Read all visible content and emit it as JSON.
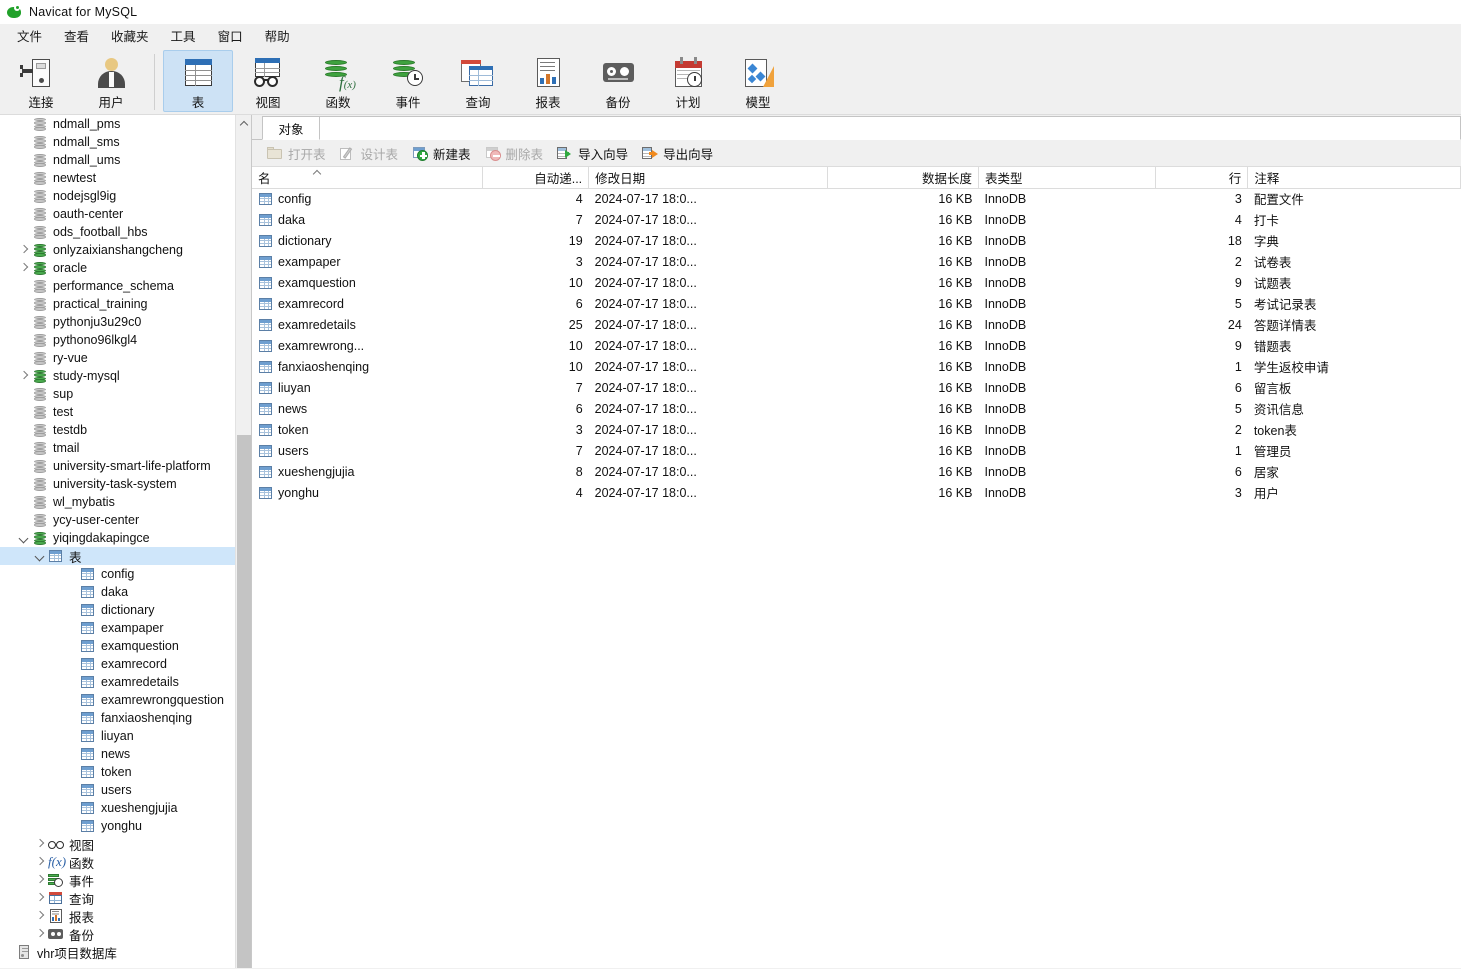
{
  "window": {
    "title": "Navicat for MySQL",
    "logo_icon": "navicat-logo-icon"
  },
  "menubar": [
    {
      "label": "文件"
    },
    {
      "label": "查看"
    },
    {
      "label": "收藏夹"
    },
    {
      "label": "工具"
    },
    {
      "label": "窗口"
    },
    {
      "label": "帮助"
    }
  ],
  "toolbar": [
    {
      "label": "连接",
      "icon": "connection-icon",
      "active": false
    },
    {
      "label": "用户",
      "icon": "user-icon",
      "active": false
    },
    {
      "label": "表",
      "icon": "table-icon",
      "active": true
    },
    {
      "label": "视图",
      "icon": "view-icon",
      "active": false
    },
    {
      "label": "函数",
      "icon": "function-icon",
      "active": false
    },
    {
      "label": "事件",
      "icon": "event-icon",
      "active": false
    },
    {
      "label": "查询",
      "icon": "query-icon",
      "active": false
    },
    {
      "label": "报表",
      "icon": "report-icon",
      "active": false
    },
    {
      "label": "备份",
      "icon": "backup-icon",
      "active": false
    },
    {
      "label": "计划",
      "icon": "schedule-icon",
      "active": false
    },
    {
      "label": "模型",
      "icon": "model-icon",
      "active": false
    }
  ],
  "sidebar": {
    "scrollbar": {
      "up_arrow_icon": "scroll-up-arrow-icon"
    },
    "nodes": [
      {
        "label": "ndmall_pms",
        "icon": "database-icon",
        "state": "closed",
        "indent": 2,
        "twisty": "none",
        "selected": false
      },
      {
        "label": "ndmall_sms",
        "icon": "database-icon",
        "state": "closed",
        "indent": 2,
        "twisty": "none",
        "selected": false
      },
      {
        "label": "ndmall_ums",
        "icon": "database-icon",
        "state": "closed",
        "indent": 2,
        "twisty": "none",
        "selected": false
      },
      {
        "label": "newtest",
        "icon": "database-icon",
        "state": "closed",
        "indent": 2,
        "twisty": "none",
        "selected": false
      },
      {
        "label": "nodejsgl9ig",
        "icon": "database-icon",
        "state": "closed",
        "indent": 2,
        "twisty": "none",
        "selected": false
      },
      {
        "label": "oauth-center",
        "icon": "database-icon",
        "state": "closed",
        "indent": 2,
        "twisty": "none",
        "selected": false
      },
      {
        "label": "ods_football_hbs",
        "icon": "database-icon",
        "state": "closed",
        "indent": 2,
        "twisty": "none",
        "selected": false
      },
      {
        "label": "onlyzaixianshangcheng",
        "icon": "database-icon",
        "state": "open",
        "indent": 2,
        "twisty": "closed",
        "selected": false
      },
      {
        "label": "oracle",
        "icon": "database-icon",
        "state": "open",
        "indent": 2,
        "twisty": "closed",
        "selected": false
      },
      {
        "label": "performance_schema",
        "icon": "database-icon",
        "state": "closed",
        "indent": 2,
        "twisty": "none",
        "selected": false
      },
      {
        "label": "practical_training",
        "icon": "database-icon",
        "state": "closed",
        "indent": 2,
        "twisty": "none",
        "selected": false
      },
      {
        "label": "pythonju3u29c0",
        "icon": "database-icon",
        "state": "closed",
        "indent": 2,
        "twisty": "none",
        "selected": false
      },
      {
        "label": "pythono96lkgl4",
        "icon": "database-icon",
        "state": "closed",
        "indent": 2,
        "twisty": "none",
        "selected": false
      },
      {
        "label": "ry-vue",
        "icon": "database-icon",
        "state": "closed",
        "indent": 2,
        "twisty": "none",
        "selected": false
      },
      {
        "label": "study-mysql",
        "icon": "database-icon",
        "state": "open",
        "indent": 2,
        "twisty": "closed",
        "selected": false
      },
      {
        "label": "sup",
        "icon": "database-icon",
        "state": "closed",
        "indent": 2,
        "twisty": "none",
        "selected": false
      },
      {
        "label": "test",
        "icon": "database-icon",
        "state": "closed",
        "indent": 2,
        "twisty": "none",
        "selected": false
      },
      {
        "label": "testdb",
        "icon": "database-icon",
        "state": "closed",
        "indent": 2,
        "twisty": "none",
        "selected": false
      },
      {
        "label": "tmail",
        "icon": "database-icon",
        "state": "closed",
        "indent": 2,
        "twisty": "none",
        "selected": false
      },
      {
        "label": "university-smart-life-platform",
        "icon": "database-icon",
        "state": "closed",
        "indent": 2,
        "twisty": "none",
        "selected": false
      },
      {
        "label": "university-task-system",
        "icon": "database-icon",
        "state": "closed",
        "indent": 2,
        "twisty": "none",
        "selected": false
      },
      {
        "label": "wl_mybatis",
        "icon": "database-icon",
        "state": "closed",
        "indent": 2,
        "twisty": "none",
        "selected": false
      },
      {
        "label": "ycy-user-center",
        "icon": "database-icon",
        "state": "closed",
        "indent": 2,
        "twisty": "none",
        "selected": false
      },
      {
        "label": "yiqingdakapingce",
        "icon": "database-icon",
        "state": "open",
        "indent": 2,
        "twisty": "open",
        "selected": false
      },
      {
        "label": "表",
        "icon": "tables-folder-icon",
        "state": "",
        "indent": 3,
        "twisty": "open",
        "selected": true
      },
      {
        "label": "config",
        "icon": "table-item-icon",
        "state": "",
        "indent": 5,
        "twisty": "none",
        "selected": false
      },
      {
        "label": "daka",
        "icon": "table-item-icon",
        "state": "",
        "indent": 5,
        "twisty": "none",
        "selected": false
      },
      {
        "label": "dictionary",
        "icon": "table-item-icon",
        "state": "",
        "indent": 5,
        "twisty": "none",
        "selected": false
      },
      {
        "label": "exampaper",
        "icon": "table-item-icon",
        "state": "",
        "indent": 5,
        "twisty": "none",
        "selected": false
      },
      {
        "label": "examquestion",
        "icon": "table-item-icon",
        "state": "",
        "indent": 5,
        "twisty": "none",
        "selected": false
      },
      {
        "label": "examrecord",
        "icon": "table-item-icon",
        "state": "",
        "indent": 5,
        "twisty": "none",
        "selected": false
      },
      {
        "label": "examredetails",
        "icon": "table-item-icon",
        "state": "",
        "indent": 5,
        "twisty": "none",
        "selected": false
      },
      {
        "label": "examrewrongquestion",
        "icon": "table-item-icon",
        "state": "",
        "indent": 5,
        "twisty": "none",
        "selected": false
      },
      {
        "label": "fanxiaoshenqing",
        "icon": "table-item-icon",
        "state": "",
        "indent": 5,
        "twisty": "none",
        "selected": false
      },
      {
        "label": "liuyan",
        "icon": "table-item-icon",
        "state": "",
        "indent": 5,
        "twisty": "none",
        "selected": false
      },
      {
        "label": "news",
        "icon": "table-item-icon",
        "state": "",
        "indent": 5,
        "twisty": "none",
        "selected": false
      },
      {
        "label": "token",
        "icon": "table-item-icon",
        "state": "",
        "indent": 5,
        "twisty": "none",
        "selected": false
      },
      {
        "label": "users",
        "icon": "table-item-icon",
        "state": "",
        "indent": 5,
        "twisty": "none",
        "selected": false
      },
      {
        "label": "xueshengjujia",
        "icon": "table-item-icon",
        "state": "",
        "indent": 5,
        "twisty": "none",
        "selected": false
      },
      {
        "label": "yonghu",
        "icon": "table-item-icon",
        "state": "",
        "indent": 5,
        "twisty": "none",
        "selected": false
      },
      {
        "label": "视图",
        "icon": "views-icon",
        "state": "",
        "indent": 3,
        "twisty": "closed",
        "selected": false
      },
      {
        "label": "函数",
        "icon": "functions-icon",
        "state": "",
        "indent": 3,
        "twisty": "closed",
        "selected": false
      },
      {
        "label": "事件",
        "icon": "events-icon",
        "state": "",
        "indent": 3,
        "twisty": "closed",
        "selected": false
      },
      {
        "label": "查询",
        "icon": "queries-icon",
        "state": "",
        "indent": 3,
        "twisty": "closed",
        "selected": false
      },
      {
        "label": "报表",
        "icon": "reports-icon",
        "state": "",
        "indent": 3,
        "twisty": "closed",
        "selected": false
      },
      {
        "label": "备份",
        "icon": "backups-icon",
        "state": "",
        "indent": 3,
        "twisty": "closed",
        "selected": false
      },
      {
        "label": "vhr项目数据库",
        "icon": "server-icon",
        "state": "",
        "indent": 1,
        "twisty": "none",
        "selected": false
      }
    ]
  },
  "tabs": [
    {
      "label": "对象",
      "active": true
    }
  ],
  "actions": [
    {
      "label": "打开表",
      "icon": "open-table-icon",
      "disabled": true
    },
    {
      "label": "设计表",
      "icon": "design-table-icon",
      "disabled": true
    },
    {
      "label": "新建表",
      "icon": "new-table-icon",
      "disabled": false
    },
    {
      "label": "删除表",
      "icon": "delete-table-icon",
      "disabled": true
    },
    {
      "label": "导入向导",
      "icon": "import-wizard-icon",
      "disabled": false
    },
    {
      "label": "导出向导",
      "icon": "export-wizard-icon",
      "disabled": false
    }
  ],
  "grid": {
    "sort_column": "名",
    "sort_direction": "asc",
    "columns": [
      {
        "label": "名",
        "align": "left"
      },
      {
        "label": "自动递...",
        "align": "right"
      },
      {
        "label": "修改日期",
        "align": "left"
      },
      {
        "label": "数据长度",
        "align": "right"
      },
      {
        "label": "表类型",
        "align": "left"
      },
      {
        "label": "行",
        "align": "right"
      },
      {
        "label": "注释",
        "align": "left"
      }
    ],
    "rows": [
      {
        "name": "config",
        "auto_increment": "4",
        "modified": "2024-07-17 18:0...",
        "data_length": "16 KB",
        "engine": "InnoDB",
        "rows": "3",
        "comment": "配置文件"
      },
      {
        "name": "daka",
        "auto_increment": "7",
        "modified": "2024-07-17 18:0...",
        "data_length": "16 KB",
        "engine": "InnoDB",
        "rows": "4",
        "comment": "打卡"
      },
      {
        "name": "dictionary",
        "auto_increment": "19",
        "modified": "2024-07-17 18:0...",
        "data_length": "16 KB",
        "engine": "InnoDB",
        "rows": "18",
        "comment": "字典"
      },
      {
        "name": "exampaper",
        "auto_increment": "3",
        "modified": "2024-07-17 18:0...",
        "data_length": "16 KB",
        "engine": "InnoDB",
        "rows": "2",
        "comment": "试卷表"
      },
      {
        "name": "examquestion",
        "auto_increment": "10",
        "modified": "2024-07-17 18:0...",
        "data_length": "16 KB",
        "engine": "InnoDB",
        "rows": "9",
        "comment": "试题表"
      },
      {
        "name": "examrecord",
        "auto_increment": "6",
        "modified": "2024-07-17 18:0...",
        "data_length": "16 KB",
        "engine": "InnoDB",
        "rows": "5",
        "comment": "考试记录表"
      },
      {
        "name": "examredetails",
        "auto_increment": "25",
        "modified": "2024-07-17 18:0...",
        "data_length": "16 KB",
        "engine": "InnoDB",
        "rows": "24",
        "comment": "答题详情表"
      },
      {
        "name": "examrewrong...",
        "auto_increment": "10",
        "modified": "2024-07-17 18:0...",
        "data_length": "16 KB",
        "engine": "InnoDB",
        "rows": "9",
        "comment": "错题表"
      },
      {
        "name": "fanxiaoshenqing",
        "auto_increment": "10",
        "modified": "2024-07-17 18:0...",
        "data_length": "16 KB",
        "engine": "InnoDB",
        "rows": "1",
        "comment": "学生返校申请"
      },
      {
        "name": "liuyan",
        "auto_increment": "7",
        "modified": "2024-07-17 18:0...",
        "data_length": "16 KB",
        "engine": "InnoDB",
        "rows": "6",
        "comment": "留言板"
      },
      {
        "name": "news",
        "auto_increment": "6",
        "modified": "2024-07-17 18:0...",
        "data_length": "16 KB",
        "engine": "InnoDB",
        "rows": "5",
        "comment": "资讯信息"
      },
      {
        "name": "token",
        "auto_increment": "3",
        "modified": "2024-07-17 18:0...",
        "data_length": "16 KB",
        "engine": "InnoDB",
        "rows": "2",
        "comment": "token表"
      },
      {
        "name": "users",
        "auto_increment": "7",
        "modified": "2024-07-17 18:0...",
        "data_length": "16 KB",
        "engine": "InnoDB",
        "rows": "1",
        "comment": "管理员"
      },
      {
        "name": "xueshengjujia",
        "auto_increment": "8",
        "modified": "2024-07-17 18:0...",
        "data_length": "16 KB",
        "engine": "InnoDB",
        "rows": "6",
        "comment": "居家"
      },
      {
        "name": "yonghu",
        "auto_increment": "4",
        "modified": "2024-07-17 18:0...",
        "data_length": "16 KB",
        "engine": "InnoDB",
        "rows": "3",
        "comment": "用户"
      }
    ]
  }
}
